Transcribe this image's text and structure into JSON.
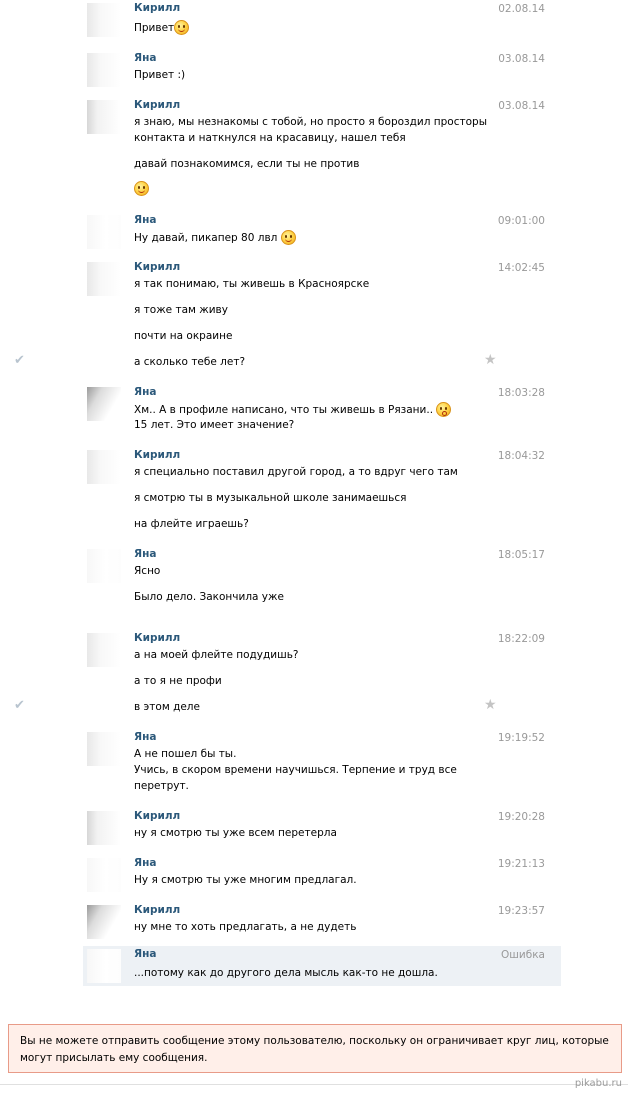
{
  "messages": [
    {
      "author": "Кирилл",
      "time": "02.08.14",
      "lines": [
        "Привет"
      ]
    },
    {
      "author": "Яна",
      "time": "03.08.14",
      "lines": [
        "Привет :)"
      ]
    },
    {
      "author": "Кирилл",
      "time": "03.08.14",
      "lines": [
        "я знаю, мы незнакомы с тобой, но просто я бороздил просторы",
        "контакта и наткнулся на красавицу, нашел тебя",
        "давай познакомимся, если ты не против"
      ]
    },
    {
      "author": "Яна",
      "time": "09:01:00",
      "lines": [
        "Ну давай, пикапер 80 лвл"
      ]
    },
    {
      "author": "Кирилл",
      "time": "14:02:45",
      "lines": [
        "я так понимаю, ты живешь в Красноярске",
        "я тоже там живу",
        "почти на окраине",
        "а сколько тебе лет?"
      ]
    },
    {
      "author": "Яна",
      "time": "18:03:28",
      "lines": [
        "Хм.. А в профиле написано, что ты живешь в Рязани..",
        "15 лет. Это имеет значение?"
      ]
    },
    {
      "author": "Кирилл",
      "time": "18:04:32",
      "lines": [
        "я специально поставил другой город, а то вдруг чего там",
        "я смотрю ты в музыкальной школе занимаешься",
        "на флейте играешь?"
      ]
    },
    {
      "author": "Яна",
      "time": "18:05:17",
      "lines": [
        "Ясно",
        "Было дело. Закончила уже"
      ]
    },
    {
      "author": "Кирилл",
      "time": "18:22:09",
      "lines": [
        "а на моей флейте подудишь?",
        "а то я не профи",
        "в этом деле"
      ]
    },
    {
      "author": "Яна",
      "time": "19:19:52",
      "lines": [
        "А не пошел бы ты.",
        "Учись, в скором времени научишься. Терпение и труд все",
        "перетрут."
      ]
    },
    {
      "author": "Кирилл",
      "time": "19:20:28",
      "lines": [
        "ну я смотрю ты уже всем перетерла"
      ]
    },
    {
      "author": "Яна",
      "time": "19:21:13",
      "lines": [
        "Ну я смотрю ты уже многим предлагал."
      ]
    },
    {
      "author": "Кирилл",
      "time": "19:23:57",
      "lines": [
        "ну мне то хоть предлагать, а не дудеть"
      ]
    },
    {
      "author": "Яна",
      "time": "Ошибка",
      "lines": [
        "...потому как до другого дела мысль как-то не дошла."
      ]
    }
  ],
  "error_notice": "Вы не можете отправить сообщение этому пользователю, поскольку он ограничивает круг лиц, которые могут присылать ему сообщения.",
  "icons": {
    "check": "checkmark-icon",
    "star": "star-icon",
    "emoji_smile": "smile-emoji-icon",
    "emoji_surprised": "surprised-emoji-icon"
  },
  "watermark": "pikabu.ru",
  "colors": {
    "author": "#2b587a",
    "time": "#999999",
    "highlight": "#edf1f5",
    "error_bg": "#ffefe9",
    "error_border": "#e89b88"
  }
}
